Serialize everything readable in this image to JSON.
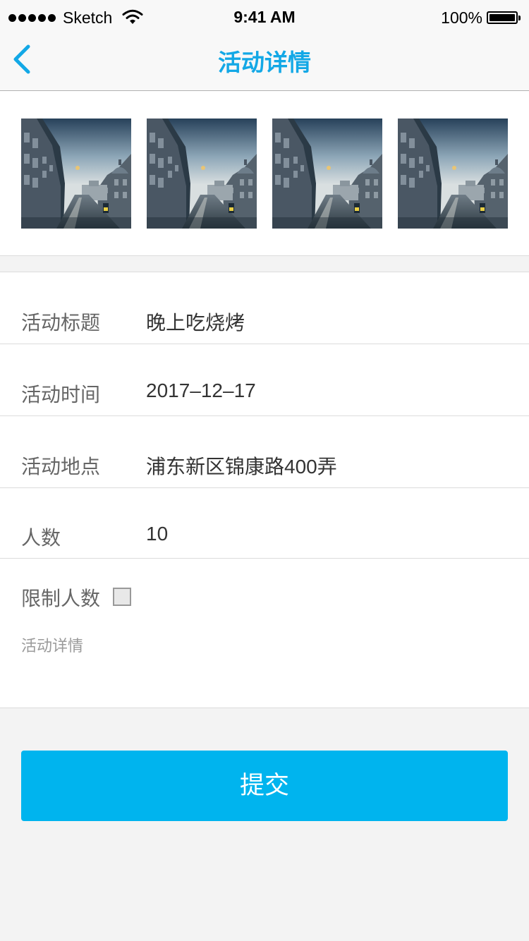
{
  "status_bar": {
    "carrier": "Sketch",
    "time": "9:41 AM",
    "battery_percent": "100%",
    "signal_bars": 5,
    "battery_level": 1.0
  },
  "nav": {
    "title": "活动详情",
    "back_icon": "chevron-left-icon",
    "accent_color": "#13a8e6"
  },
  "photos": {
    "count": 4,
    "subject": "city street with domed building"
  },
  "form": {
    "rows": [
      {
        "label": "活动标题",
        "value": "晚上吃烧烤"
      },
      {
        "label": "活动时间",
        "value": "2017–12–17"
      },
      {
        "label": "活动地点",
        "value": "浦东新区锦康路400弄"
      },
      {
        "label": "人数",
        "value": "10"
      }
    ],
    "limit_label": "限制人数",
    "limit_checked": false,
    "detail_placeholder": "活动详情"
  },
  "submit": {
    "label": "提交",
    "color": "#00b4ee"
  }
}
